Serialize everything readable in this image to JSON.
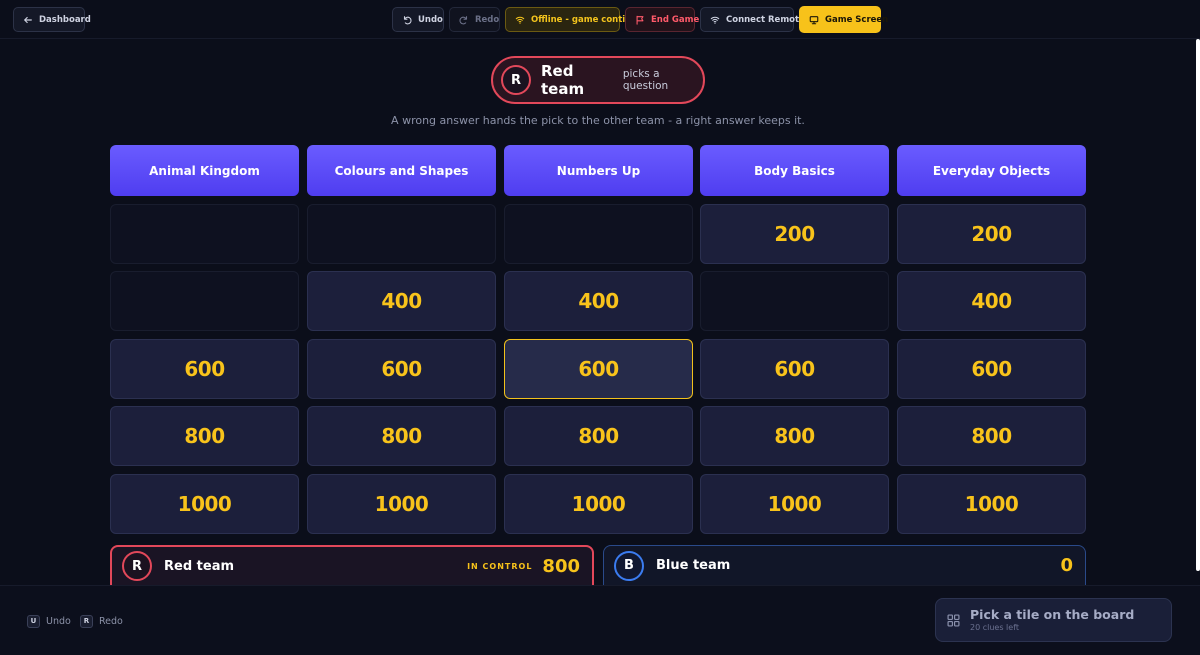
{
  "toolbar": {
    "dashboard_label": "Dashboard",
    "undo_label": "Undo",
    "redo_label": "Redo",
    "offline_label": "Offline - game continues",
    "end_game_label": "End Game",
    "connect_remote_label": "Connect Remote",
    "game_screen_label": "Game Screen"
  },
  "turn": {
    "avatar_letter": "R",
    "team": "Red team",
    "text": "picks a question"
  },
  "hint": "A wrong answer hands the pick to the other team - a right answer keeps it.",
  "board": {
    "categories": [
      "Animal Kingdom",
      "Colours and Shapes",
      "Numbers Up",
      "Body Basics",
      "Everyday Objects"
    ],
    "rows": [
      [
        "",
        "",
        "",
        "200",
        "200"
      ],
      [
        "",
        "400",
        "400",
        "",
        "400"
      ],
      [
        "600",
        "600",
        "600",
        "600",
        "600"
      ],
      [
        "800",
        "800",
        "800",
        "800",
        "800"
      ],
      [
        "1000",
        "1000",
        "1000",
        "1000",
        "1000"
      ]
    ]
  },
  "scores": {
    "red": {
      "avatar_letter": "R",
      "name": "Red team",
      "status": "IN CONTROL",
      "score": "800"
    },
    "blue": {
      "avatar_letter": "B",
      "name": "Blue team",
      "score": "0"
    }
  },
  "shortcuts": {
    "undo_key": "U",
    "undo_label": "Undo",
    "redo_key": "R",
    "redo_label": "Redo"
  },
  "pick_panel": {
    "title": "Pick a tile on the board",
    "subtitle": "20 clues left"
  },
  "colors": {
    "accent": "#f7c21a",
    "category": "#5b4bf5",
    "red_team": "#e2485a",
    "blue_team": "#3b7cf0"
  }
}
